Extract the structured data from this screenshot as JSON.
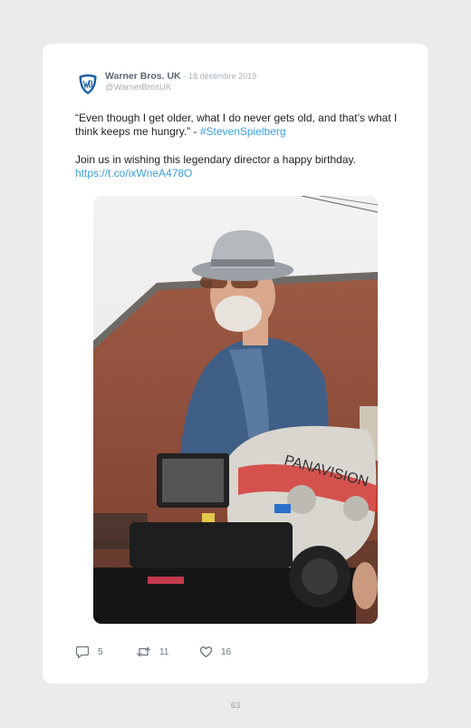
{
  "tweet": {
    "author_name": "Warner Bros. UK",
    "date": "· 18 décembre 2019",
    "handle": "@WarnerBrosUK",
    "quote_text": "“Even though I get older, what I do never gets old, and that’s what I think keeps me hungry.” - ",
    "hashtag": "#StevenSpielberg",
    "second_text": "Join us in wishing this legendary director a happy birthday.",
    "url": "https://t.co/ixWneA478O",
    "image_alt": "Man in grey hat and denim jacket standing behind a Panavision camera",
    "logo_icon": "wb-shield-icon"
  },
  "actions": {
    "reply_count": "5",
    "retweet_count": "11",
    "like_count": "16"
  },
  "colors": {
    "link": "#3ba0e0",
    "logo_blue": "#1f5fa8"
  },
  "page": {
    "number": "63"
  }
}
